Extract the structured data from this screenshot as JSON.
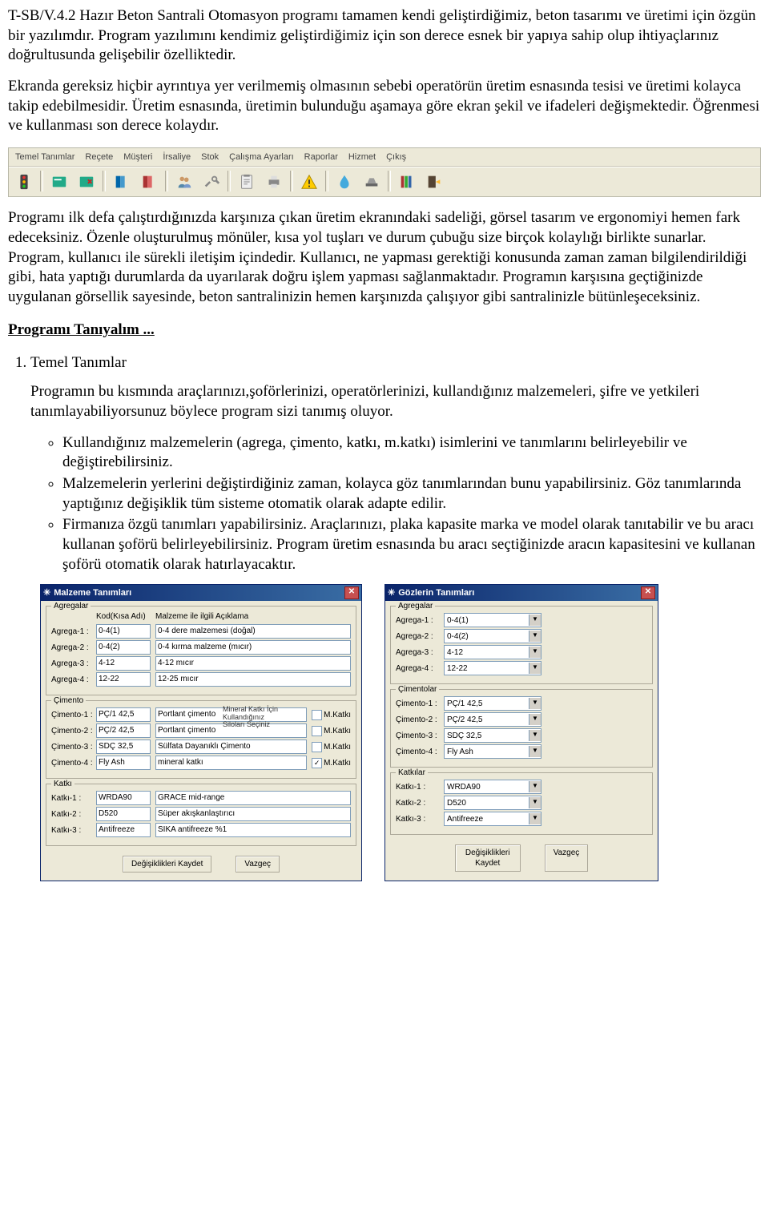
{
  "para1": "T-SB/V.4.2 Hazır Beton Santrali Otomasyon programı tamamen kendi geliştirdiğimiz, beton tasarımı ve üretimi için özgün bir yazılımdır. Program yazılımını kendimiz geliştirdiğimiz için son derece esnek bir yapıya sahip olup ihtiyaçlarınız doğrultusunda gelişebilir özelliktedir.",
  "para2": "Ekranda gereksiz hiçbir ayrıntıya yer verilmemiş olmasının sebebi operatörün üretim esnasında tesisi ve üretimi kolayca takip edebilmesidir. Üretim esnasında, üretimin bulunduğu aşamaya göre ekran şekil ve ifadeleri değişmektedir. Öğrenmesi ve kullanması son derece kolaydır.",
  "menus": [
    "Temel Tanımlar",
    "Reçete",
    "Müşteri",
    "İrsaliye",
    "Stok",
    "Çalışma Ayarları",
    "Raporlar",
    "Hizmet",
    "Çıkış"
  ],
  "para3": "Programı ilk defa çalıştırdığınızda karşınıza çıkan üretim ekranındaki sadeliği, görsel tasarım ve ergonomiyi hemen fark edeceksiniz. Özenle oluşturulmuş mönüler, kısa yol tuşları ve durum çubuğu size birçok kolaylığı birlikte sunarlar. Program, kullanıcı ile sürekli iletişim içindedir. Kullanıcı, ne yapması gerektiği konusunda zaman zaman bilgilendirildiği gibi, hata yaptığı durumlarda da uyarılarak doğru işlem yapması sağlanmaktadır. Programın karşısına geçtiğinizde uygulanan görsellik sayesinde, beton santralinizin hemen karşınızda çalışıyor gibi santralinizle bütünleşeceksiniz.",
  "sect_title": "Programı Tanıyalım ...",
  "num1": "Temel Tanımlar",
  "para4": "Programın bu kısmında araçlarınızı,şoförlerinizi, operatörlerinizi, kullandığınız malzemeleri, şifre ve yetkileri tanımlayabiliyorsunuz böylece program sizi tanımış oluyor.",
  "b1": "Kullandığınız malzemelerin (agrega, çimento, katkı, m.katkı) isimlerini ve tanımlarını belirleyebilir ve değiştirebilirsiniz.",
  "b2": "Malzemelerin yerlerini değiştirdiğiniz zaman, kolayca göz tanımlarından bunu yapabilirsiniz. Göz tanımlarında yaptığınız değişiklik tüm sisteme otomatik olarak adapte edilir.",
  "b3": "Firmanıza özgü tanımları yapabilirsiniz. Araçlarınızı, plaka kapasite marka ve model olarak tanıtabilir ve bu aracı kullanan şoförü belirleyebilirsiniz. Program üretim esnasında bu aracı seçtiğinizde aracın kapasitesini ve kullanan şoförü otomatik olarak hatırlayacaktır.",
  "dlg1": {
    "title": "Malzeme Tanımları",
    "grp_agg": "Agregalar",
    "h_code": "Kod(Kısa Adı)",
    "h_desc": "Malzeme ile ilgili Açıklama",
    "rows_agg": [
      {
        "l": "Agrega-1 :",
        "c": "0-4(1)",
        "d": "0-4 dere malzemesi (doğal)"
      },
      {
        "l": "Agrega-2 :",
        "c": "0-4(2)",
        "d": "0-4 kırma malzeme (mıcır)"
      },
      {
        "l": "Agrega-3 :",
        "c": "4-12",
        "d": "4-12 mıcır"
      },
      {
        "l": "Agrega-4 :",
        "c": "12-22",
        "d": "12-25 mıcır"
      }
    ],
    "grp_cem": "Çimento",
    "mineral_hint": "Mineral Katkı İçin Kullandığınız Siloları Seçiniz",
    "chk_label": "M.Katkı",
    "rows_cem": [
      {
        "l": "Çimento-1 :",
        "c": "PÇ/1 42,5",
        "d": "Portlant çimento",
        "chk": false
      },
      {
        "l": "Çimento-2 :",
        "c": "PÇ/2 42,5",
        "d": "Portlant çimento",
        "chk": false
      },
      {
        "l": "Çimento-3 :",
        "c": "SDÇ 32,5",
        "d": "Sülfata Dayanıklı Çimento",
        "chk": false
      },
      {
        "l": "Çimento-4 :",
        "c": "Fly Ash",
        "d": "mineral katkı",
        "chk": true
      }
    ],
    "grp_kat": "Katkı",
    "rows_kat": [
      {
        "l": "Katkı-1 :",
        "c": "WRDA90",
        "d": "GRACE mid-range"
      },
      {
        "l": "Katkı-2 :",
        "c": "D520",
        "d": "Süper akışkanlaştırıcı"
      },
      {
        "l": "Katkı-3 :",
        "c": "Antifreeze",
        "d": "SIKA antifreeze %1"
      }
    ],
    "btn_save": "Değişiklikleri Kaydet",
    "btn_cancel": "Vazgeç"
  },
  "dlg2": {
    "title": "Gözlerin Tanımları",
    "grp_agg": "Agregalar",
    "rows_agg": [
      {
        "l": "Agrega-1 :",
        "v": "0-4(1)"
      },
      {
        "l": "Agrega-2 :",
        "v": "0-4(2)"
      },
      {
        "l": "Agrega-3 :",
        "v": "4-12"
      },
      {
        "l": "Agrega-4 :",
        "v": "12-22"
      }
    ],
    "grp_cem": "Çimentolar",
    "rows_cem": [
      {
        "l": "Çimento-1 :",
        "v": "PÇ/1 42,5"
      },
      {
        "l": "Çimento-2 :",
        "v": "PÇ/2 42,5"
      },
      {
        "l": "Çimento-3 :",
        "v": "SDÇ 32,5"
      },
      {
        "l": "Çimento-4 :",
        "v": "Fly Ash"
      }
    ],
    "grp_kat": "Katkılar",
    "rows_kat": [
      {
        "l": "Katkı-1 :",
        "v": "WRDA90"
      },
      {
        "l": "Katkı-2 :",
        "v": "D520"
      },
      {
        "l": "Katkı-3 :",
        "v": "Antifreeze"
      }
    ],
    "btn_save": "Değişiklikleri Kaydet",
    "btn_cancel": "Vazgeç"
  }
}
